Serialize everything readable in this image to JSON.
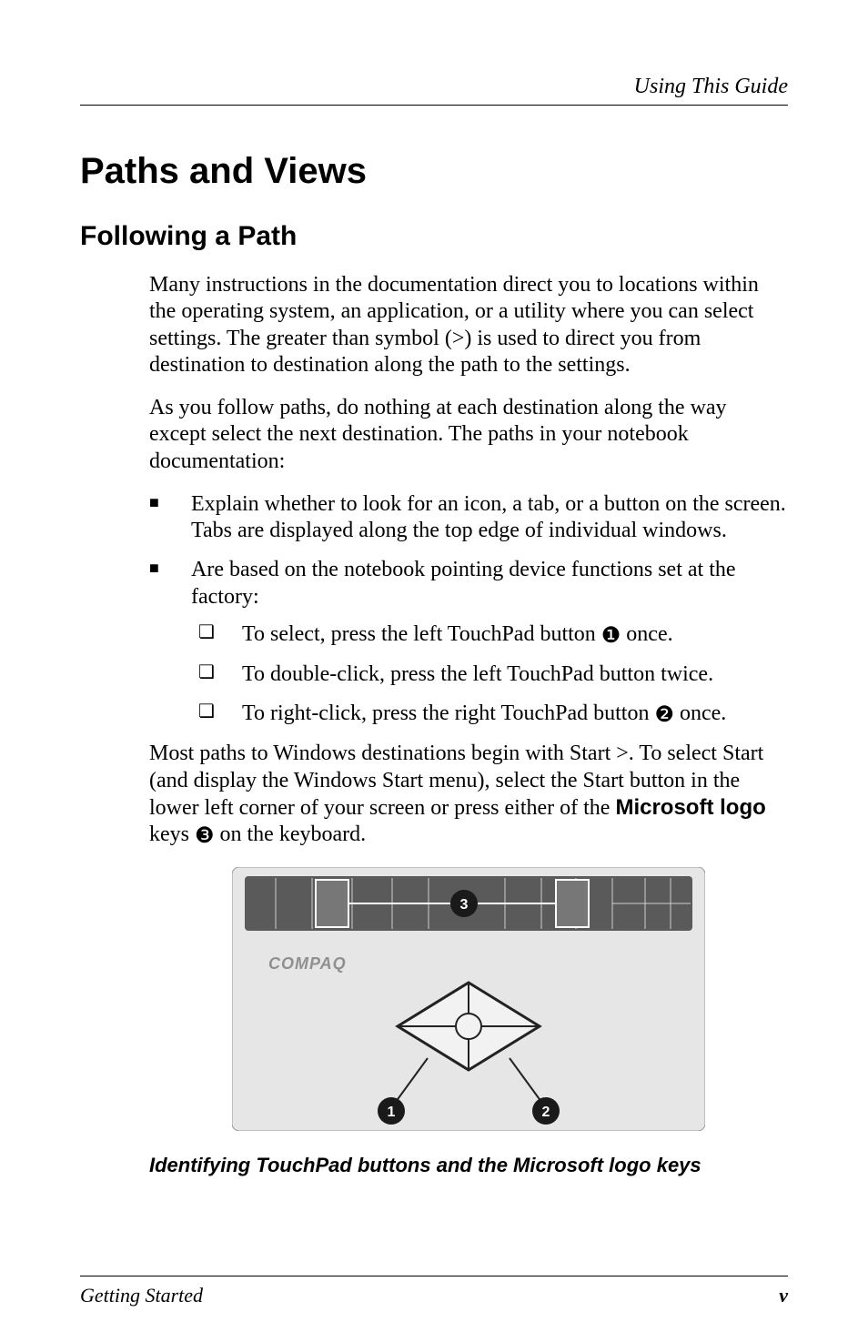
{
  "header": {
    "running": "Using This Guide"
  },
  "h1": "Paths and Views",
  "h2": "Following a Path",
  "p1": "Many instructions in the documentation direct you to locations within the operating system, an application, or a utility where you can select settings. The greater than symbol (>) is used to direct you from destination to destination along the path to the settings.",
  "p2": "As you follow paths, do nothing at each destination along the way except select the next destination. The paths in your notebook documentation:",
  "b1": "Explain whether to look for an icon, a tab, or a button on the screen. Tabs are displayed along the top edge of individual windows.",
  "b2": "Are based on the notebook pointing device functions set at the factory:",
  "s1a": "To select, press the left TouchPad button ",
  "s1b": " once.",
  "s2": "To double-click, press the left TouchPad button twice.",
  "s3a": "To right-click, press the right TouchPad button ",
  "s3b": " once.",
  "p3a": "Most paths to Windows destinations begin with Start >. To select Start (and display the Windows Start menu), select the Start button in the lower left corner of your screen or press either of the ",
  "p3bold": "Microsoft logo",
  "p3b": " keys ",
  "p3c": " on the keyboard.",
  "glyph1": "❶",
  "glyph2": "❷",
  "glyph3": "❸",
  "caption": "Identifying TouchPad buttons and the Microsoft logo keys",
  "footer": {
    "left": "Getting Started",
    "right": "v"
  },
  "figure": {
    "brand": "COMPAQ",
    "c1": "1",
    "c2": "2",
    "c3": "3"
  }
}
